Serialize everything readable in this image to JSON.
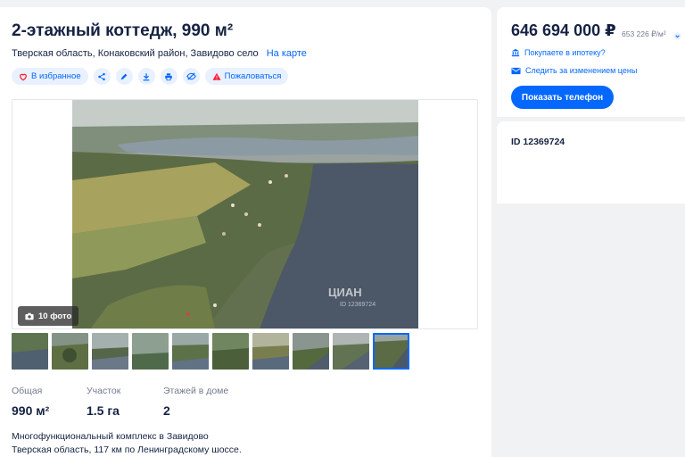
{
  "listing": {
    "title": "2-этажный коттедж, 990 м²",
    "address": "Тверская область, Конаковский район, Завидово село",
    "map_link": "На карте"
  },
  "actions": {
    "favorite": "В избранное",
    "report": "Пожаловаться"
  },
  "gallery": {
    "photo_count": "10 фото",
    "watermark_brand": "ЦИАН",
    "watermark_id": "ID 12369724",
    "thumbnails": 10,
    "active_thumbnail": 10
  },
  "facts": [
    {
      "label": "Общая",
      "value": "990 м²"
    },
    {
      "label": "Участок",
      "value": "1.5 га"
    },
    {
      "label": "Этажей в доме",
      "value": "2"
    }
  ],
  "description": {
    "line1": "Многофункциональный комплекс в Завидово",
    "line2": "Тверская область, 117 км по Ленинградскому шоссе."
  },
  "sidebar": {
    "price": "646 694 000 ₽",
    "price_per_sqm": "653 226 ₽/м²",
    "mortgage_link": "Покупаете в ипотеку?",
    "subscribe_link": "Следить за изменением цены",
    "phone_button": "Показать телефон",
    "listing_id": "ID 12369724"
  },
  "colors": {
    "accent": "#0468ff",
    "report": "#ff1f34",
    "text": "#152242",
    "muted": "#737a8e"
  },
  "icons": [
    "heart-icon",
    "share-icon",
    "pencil-icon",
    "download-icon",
    "print-icon",
    "hide-icon",
    "warning-icon",
    "camera-icon",
    "bank-icon",
    "mail-icon",
    "chevron-down-icon"
  ]
}
